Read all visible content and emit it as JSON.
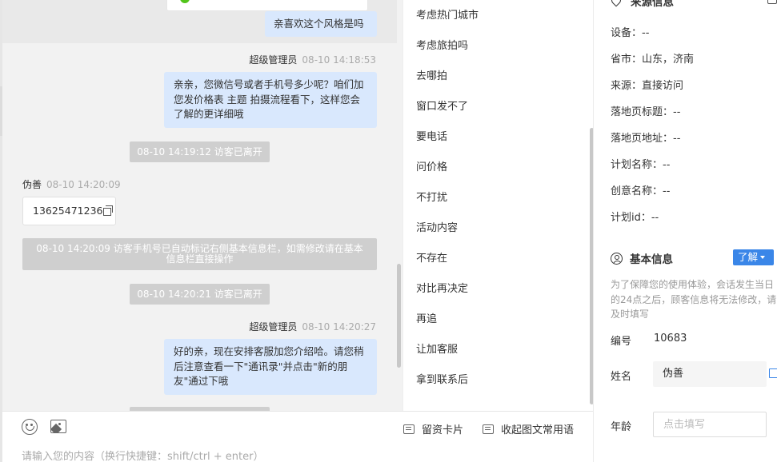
{
  "chat": {
    "prev_bubble": "亲喜欢这个风格是吗",
    "messages": [
      {
        "sender": "超级管理员",
        "time": "08-10 14:18:53",
        "text": "亲亲，您微信号或者手机号多少呢？咱们加您发价格表 主题 拍摄流程看下，这样您会了解的更详细哦"
      },
      {
        "system": "08-10 14:19:12 访客已离开"
      },
      {
        "sender": "伪善",
        "time": "08-10 14:20:09",
        "phone": "13625471236"
      },
      {
        "system": "08-10 14:20:09 访客手机号已自动标记右侧基本信息栏，如需修改请在基本信息栏直接操作"
      },
      {
        "system": "08-10 14:20:21 访客已离开"
      },
      {
        "sender": "超级管理员",
        "time": "08-10 14:20:27",
        "text": "好的亲，现在安排客服加您介绍哈。请您稍后注意查看一下\"通讯录\"并点击\"新的朋友\"通过下哦"
      }
    ]
  },
  "composer": {
    "emoji_icon": "emoji-icon",
    "image_icon": "image-icon",
    "card_label": "留资卡片",
    "phrases_label": "收起图文常用语",
    "placeholder": "请输入您的内容（换行快捷键：shift/ctrl + enter）"
  },
  "quick_replies": [
    "考虑热门城市",
    "考虑旅拍吗",
    "去哪拍",
    "窗口发不了",
    "要电话",
    "问价格",
    "不打扰",
    "活动内容",
    "不存在",
    "对比再决定",
    "再追",
    "让加客服",
    "拿到联系后"
  ],
  "info": {
    "source_title": "来源信息",
    "source_rows": [
      "设备：--",
      "省市：山东，济南",
      "来源：直接访问",
      "落地页标题：--",
      "落地页地址：--",
      "计划名称：--",
      "创意名称：--",
      "计划id：--"
    ],
    "basic_title": "基本信息",
    "learn_label": "了解",
    "notice": "为了保障您的使用体验，会话发生当日的24点之后，顾客信息将无法修改，请及时填写",
    "id_label": "编号",
    "id_value": "10683",
    "name_label": "姓名",
    "name_value": "伪善",
    "age_label": "年龄",
    "age_placeholder": "点击填写"
  }
}
